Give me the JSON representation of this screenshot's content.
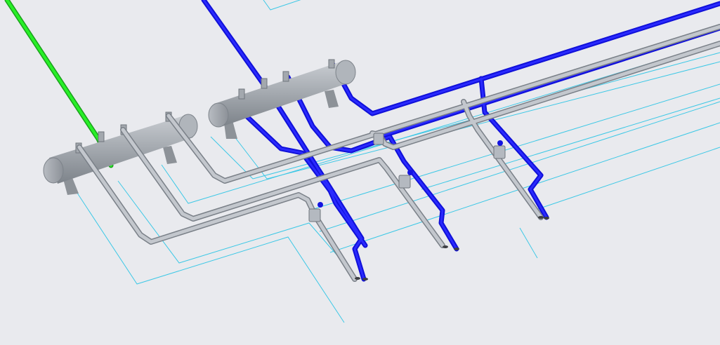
{
  "viewport": {
    "background": "#e9eaee",
    "scene": "3d-piping-model"
  },
  "colors": {
    "guide_line": "#3cc8e6",
    "pipe_blue": "#1414e0",
    "pipe_green": "#22e022",
    "pipe_gray": "#b4b9c0",
    "pipe_gray_edge": "#7a8088",
    "header_body": "#a3a8ae",
    "header_shade": "#7f858c"
  },
  "objects": {
    "headers": [
      {
        "name": "header-left"
      },
      {
        "name": "header-right"
      }
    ],
    "pipes": {
      "green": 1,
      "blue": 5,
      "gray": 5
    },
    "valves": 4
  }
}
